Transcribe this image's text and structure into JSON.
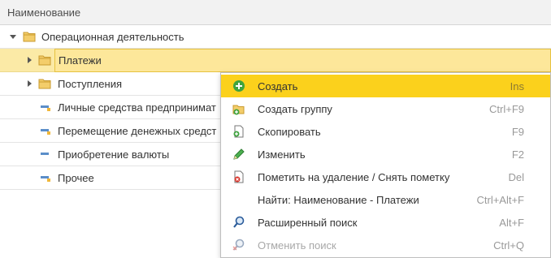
{
  "header": {
    "column_title": "Наименование"
  },
  "tree": {
    "items": [
      {
        "label": "Операционная деятельность",
        "icon": "folder-icon",
        "expanded": true
      },
      {
        "label": "Платежи",
        "icon": "folder-icon",
        "expanded": false
      },
      {
        "label": "Поступления",
        "icon": "folder-icon",
        "expanded": false
      },
      {
        "label": "Личные средства предпринимат",
        "icon": "item-icon"
      },
      {
        "label": "Перемещение денежных средст",
        "icon": "item-icon"
      },
      {
        "label": "Приобретение валюты",
        "icon": "item-icon"
      },
      {
        "label": "Прочее",
        "icon": "item-icon"
      }
    ]
  },
  "context_menu": {
    "items": [
      {
        "label": "Создать",
        "shortcut": "Ins",
        "icon": "plus-circle-icon",
        "highlighted": true,
        "disabled": false
      },
      {
        "label": "Создать группу",
        "shortcut": "Ctrl+F9",
        "icon": "add-folder-icon",
        "highlighted": false,
        "disabled": false
      },
      {
        "label": "Скопировать",
        "shortcut": "F9",
        "icon": "copy-icon",
        "highlighted": false,
        "disabled": false
      },
      {
        "label": "Изменить",
        "shortcut": "F2",
        "icon": "pencil-icon",
        "highlighted": false,
        "disabled": false
      },
      {
        "label": "Пометить на удаление / Снять пометку",
        "shortcut": "Del",
        "icon": "delete-mark-icon",
        "highlighted": false,
        "disabled": false
      },
      {
        "label": "Найти: Наименование - Платежи",
        "shortcut": "Ctrl+Alt+F",
        "icon": "",
        "highlighted": false,
        "disabled": false
      },
      {
        "label": "Расширенный поиск",
        "shortcut": "Alt+F",
        "icon": "search-icon",
        "highlighted": false,
        "disabled": false
      },
      {
        "label": "Отменить поиск",
        "shortcut": "Ctrl+Q",
        "icon": "cancel-search-icon",
        "highlighted": false,
        "disabled": true
      }
    ]
  },
  "colors": {
    "highlight": "#fbd11c",
    "selection": "#fde79a",
    "folder": "#e8b84a",
    "plus_green": "#3fa33f",
    "delete_red": "#d9342b",
    "search_blue": "#2a5b9a"
  }
}
